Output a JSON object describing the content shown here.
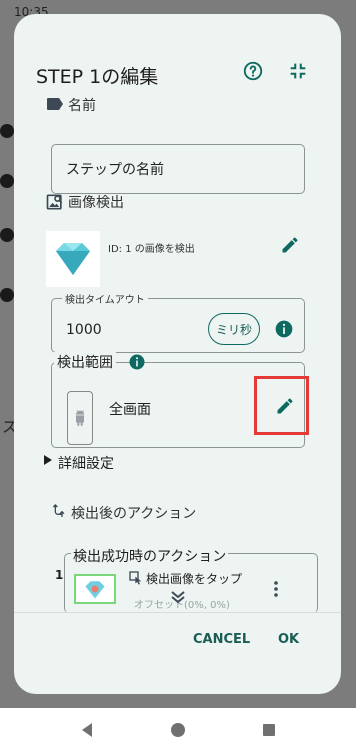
{
  "status_bar": {
    "time": "10:35"
  },
  "dialog": {
    "title": "STEP 1の編集",
    "name_section": {
      "label": "名前",
      "input_placeholder": "ステップの名前"
    },
    "image_detection": {
      "label": "画像検出",
      "description": "ID: 1 の画像を検出",
      "timeout": {
        "legend": "検出タイムアウト",
        "value": "1000",
        "unit_button": "ミリ秒"
      }
    },
    "detection_area": {
      "legend": "検出範囲",
      "value": "全画面"
    },
    "advanced_settings": {
      "label": "詳細設定"
    },
    "post_actions": {
      "label": "検出後のアクション",
      "success_legend": "検出成功時のアクション",
      "item": {
        "index": "1",
        "title": "検出画像をタップ",
        "subtitle": "オフセット(0%, 0%)"
      }
    },
    "buttons": {
      "cancel": "CANCEL",
      "ok": "OK"
    }
  },
  "background": {
    "peek_char": "ス"
  },
  "colors": {
    "accent": "#0e6a60",
    "highlight": "#e53935",
    "dialog_bg": "#eef4f2"
  }
}
